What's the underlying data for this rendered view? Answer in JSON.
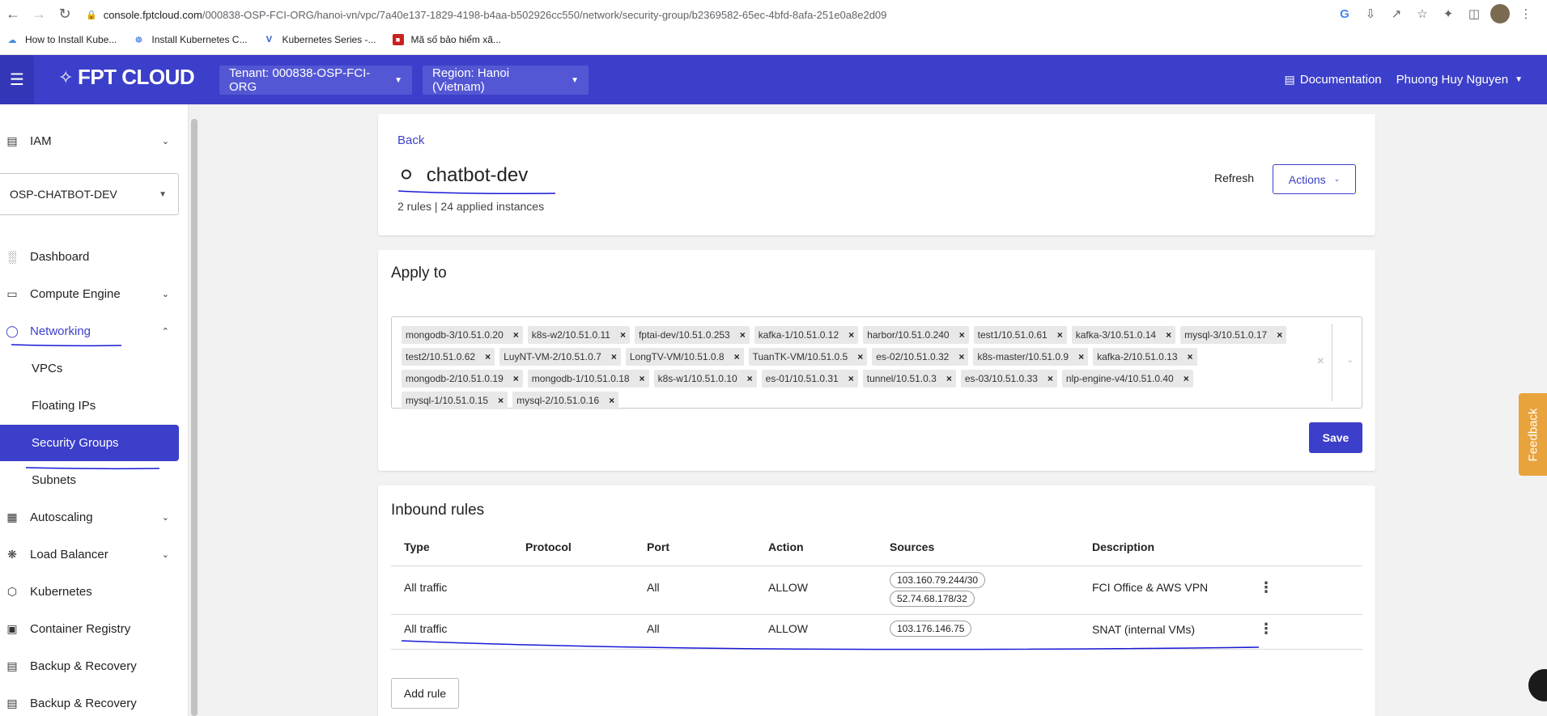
{
  "browser": {
    "url_host": "console.fptcloud.com",
    "url_path": "/000838-OSP-FCI-ORG/hanoi-vn/vpc/7a40e137-1829-4198-b4aa-b502926cc550/network/security-group/b2369582-65ec-4bfd-8afa-251e0a8e2d09",
    "bookmarks": [
      {
        "label": "How to Install Kube...",
        "icon": "cloud-icon"
      },
      {
        "label": "Install Kubernetes C...",
        "icon": "kubernetes-icon"
      },
      {
        "label": "Kubernetes Series -...",
        "icon": "v-logo-icon"
      },
      {
        "label": "Mã số bảo hiểm xã...",
        "icon": "red-bookmark-icon"
      }
    ]
  },
  "header": {
    "logo": "FPT CLOUD",
    "tenant_label": "Tenant: 000838-OSP-FCI-ORG",
    "region_label": "Region: Hanoi (Vietnam)",
    "documentation": "Documentation",
    "user_name": "Phuong Huy Nguyen",
    "brand_color": "#3c3fc9"
  },
  "sidebar": {
    "iam": "IAM",
    "project": "OSP-CHATBOT-DEV",
    "items": [
      {
        "label": "Dashboard",
        "icon": "bar-chart-icon"
      },
      {
        "label": "Compute Engine",
        "icon": "monitor-icon"
      },
      {
        "label": "Networking",
        "icon": "globe-icon"
      },
      {
        "label": "VPCs"
      },
      {
        "label": "Floating IPs"
      },
      {
        "label": "Security Groups"
      },
      {
        "label": "Subnets"
      },
      {
        "label": "Autoscaling",
        "icon": "scale-icon"
      },
      {
        "label": "Load Balancer",
        "icon": "network-icon"
      },
      {
        "label": "Kubernetes",
        "icon": "cube-icon"
      },
      {
        "label": "Container Registry",
        "icon": "registry-icon"
      },
      {
        "label": "Backup & Recovery",
        "icon": "backup-icon"
      },
      {
        "label": "Backup & Recovery",
        "icon": "backup-icon"
      }
    ]
  },
  "security_group": {
    "back": "Back",
    "name": "chatbot-dev",
    "summary": "2 rules | 24 applied instances",
    "refresh": "Refresh",
    "actions": "Actions"
  },
  "apply_to": {
    "title": "Apply to",
    "instances": [
      "mongodb-3/10.51.0.20",
      "k8s-w2/10.51.0.11",
      "fptai-dev/10.51.0.253",
      "kafka-1/10.51.0.12",
      "harbor/10.51.0.240",
      "test1/10.51.0.61",
      "kafka-3/10.51.0.14",
      "mysql-3/10.51.0.17",
      "test2/10.51.0.62",
      "LuyNT-VM-2/10.51.0.7",
      "LongTV-VM/10.51.0.8",
      "TuanTK-VM/10.51.0.5",
      "es-02/10.51.0.32",
      "k8s-master/10.51.0.9",
      "kafka-2/10.51.0.13",
      "mongodb-2/10.51.0.19",
      "mongodb-1/10.51.0.18",
      "k8s-w1/10.51.0.10",
      "es-01/10.51.0.31",
      "tunnel/10.51.0.3",
      "es-03/10.51.0.33",
      "nlp-engine-v4/10.51.0.40",
      "mysql-1/10.51.0.15",
      "mysql-2/10.51.0.16"
    ],
    "save": "Save"
  },
  "inbound": {
    "title": "Inbound rules",
    "columns": [
      "Type",
      "Protocol",
      "Port",
      "Action",
      "Sources",
      "Description"
    ],
    "rows": [
      {
        "type": "All traffic",
        "protocol": "",
        "port": "All",
        "action": "ALLOW",
        "sources": [
          "103.160.79.244/30",
          "52.74.68.178/32"
        ],
        "description": "FCI Office & AWS VPN"
      },
      {
        "type": "All traffic",
        "protocol": "",
        "port": "All",
        "action": "ALLOW",
        "sources": [
          "103.176.146.75"
        ],
        "description": "SNAT (internal VMs)"
      }
    ],
    "add_rule": "Add rule"
  },
  "feedback": "Feedback"
}
